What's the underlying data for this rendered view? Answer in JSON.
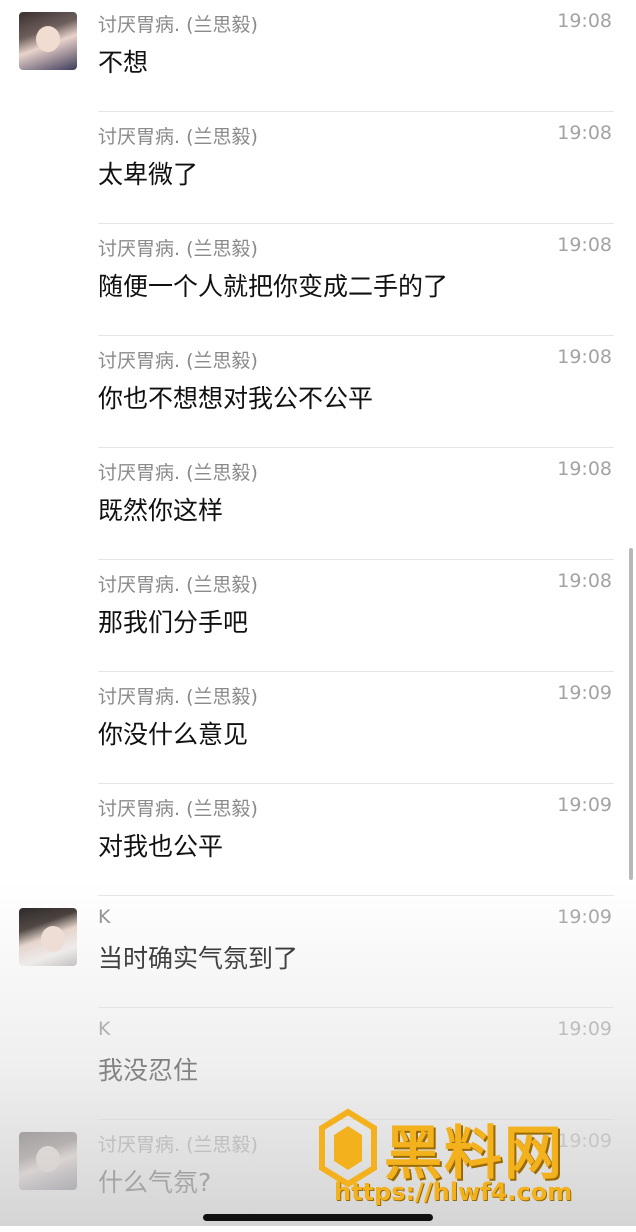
{
  "messages": [
    {
      "sender": "讨厌胃病. (兰思毅)",
      "time": "19:08",
      "text": "不想",
      "avatar": "girl-avatar-1"
    },
    {
      "sender": "讨厌胃病. (兰思毅)",
      "time": "19:08",
      "text": "太卑微了",
      "avatar": ""
    },
    {
      "sender": "讨厌胃病. (兰思毅)",
      "time": "19:08",
      "text": "随便一个人就把你变成二手的了",
      "avatar": ""
    },
    {
      "sender": "讨厌胃病. (兰思毅)",
      "time": "19:08",
      "text": "你也不想想对我公不公平",
      "avatar": ""
    },
    {
      "sender": "讨厌胃病. (兰思毅)",
      "time": "19:08",
      "text": "既然你这样",
      "avatar": ""
    },
    {
      "sender": "讨厌胃病. (兰思毅)",
      "time": "19:08",
      "text": "那我们分手吧",
      "avatar": ""
    },
    {
      "sender": "讨厌胃病. (兰思毅)",
      "time": "19:09",
      "text": "你没什么意见",
      "avatar": ""
    },
    {
      "sender": "讨厌胃病. (兰思毅)",
      "time": "19:09",
      "text": "对我也公平",
      "avatar": ""
    },
    {
      "sender": "K",
      "time": "19:09",
      "text": "当时确实气氛到了",
      "avatar": "girl-avatar-2"
    },
    {
      "sender": "K",
      "time": "19:09",
      "text": "我没忍住",
      "avatar": ""
    },
    {
      "sender": "讨厌胃病. (兰思毅)",
      "time": "19:09",
      "text": "什么气氛?",
      "avatar": "girl-avatar-1"
    }
  ],
  "watermark": {
    "title": "黑料网",
    "url": "https://hlwf4.com",
    "color": "#f3b11d"
  }
}
